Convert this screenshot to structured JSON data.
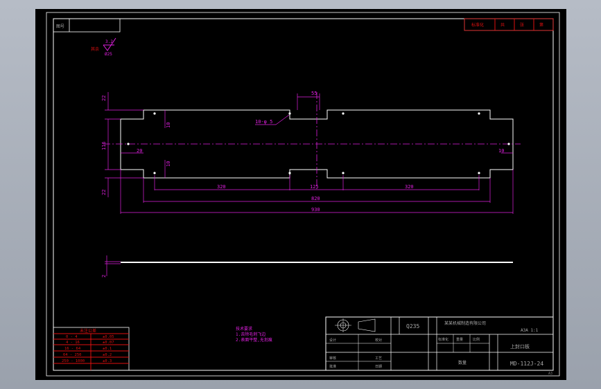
{
  "colors": {
    "background": "#000000",
    "frame": "#ffffff",
    "dimension": "#e020e0",
    "title_table": "#e01010",
    "text": "#aaaaaa"
  },
  "top_left_box": {
    "cell1": "图号"
  },
  "top_right_box": {
    "cells": [
      "标准化",
      "共",
      "张",
      "第"
    ]
  },
  "roughness": {
    "prefix": "其余",
    "value1": "3.2",
    "value2": "Ø25"
  },
  "drawing": {
    "dims": {
      "slot_width": "55",
      "holes_note": "10-φ 5",
      "left_offset": "20",
      "right_offset": "10",
      "hole_vertical_1": "10",
      "hole_vertical_2": "10",
      "height_top": "22",
      "height_total": "116",
      "height_bottom": "22",
      "span_left": "320",
      "span_center": "125",
      "span_right": "320",
      "span_holes": "820",
      "length_total": "930",
      "thickness": "2"
    }
  },
  "tolerance_table": {
    "title": "未注公差",
    "rows": [
      [
        "0 - 4",
        "±0.05"
      ],
      [
        "4 - 16",
        "±0.07"
      ],
      [
        "16 - 64",
        "±0.1"
      ],
      [
        "64 - 250",
        "±0.2"
      ],
      [
        "250 - 1000",
        "±0.3"
      ]
    ]
  },
  "notes": {
    "title": "技术要求",
    "line1": "1.去除毛刺飞边",
    "line2": "2.表面平整,无划痕"
  },
  "title_block": {
    "material": "Q235",
    "company": "某某机械制造有限公司",
    "scale": "A3A 1:1",
    "part_name": "上封口板",
    "drawing_no": "MD-112J-24",
    "labels": [
      "设计",
      "校对",
      "审核",
      "工艺",
      "标准化",
      "批准",
      "日期",
      "重量",
      "比例",
      "数量"
    ]
  },
  "corner_text": "A3"
}
